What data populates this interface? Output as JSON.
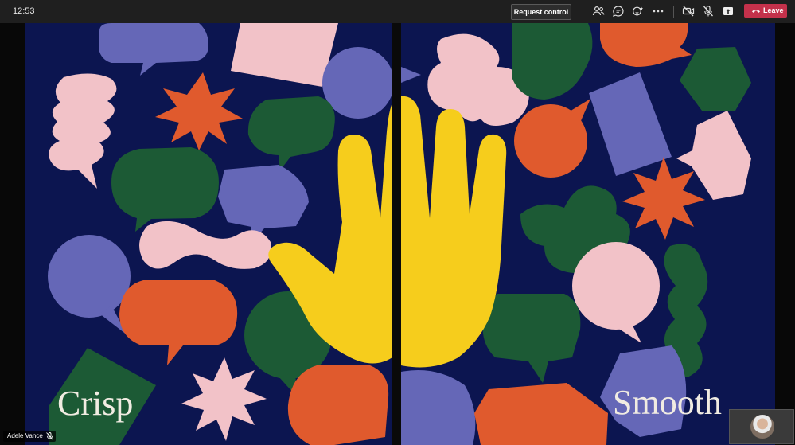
{
  "header": {
    "clock": "12:53",
    "request_control_label": "Request control",
    "leave_label": "Leave",
    "icons": [
      "participants-icon",
      "chat-icon",
      "reactions-icon",
      "more-options-icon",
      "camera-off-icon",
      "mic-off-icon",
      "share-tray-icon",
      "phone-hangup-icon"
    ],
    "leave_color": "#c4314b"
  },
  "stage": {
    "left_caption": "Crisp",
    "right_caption": "Smooth"
  },
  "participant": {
    "name": "Adele Vance",
    "mic_state_icon": "mic-off-icon"
  },
  "palette": {
    "navy": "#0c1550",
    "periwinkle": "#6567b7",
    "pink": "#f2c2c8",
    "green": "#1c5a35",
    "orange": "#e05a2d",
    "yellow": "#f6cd1c"
  }
}
